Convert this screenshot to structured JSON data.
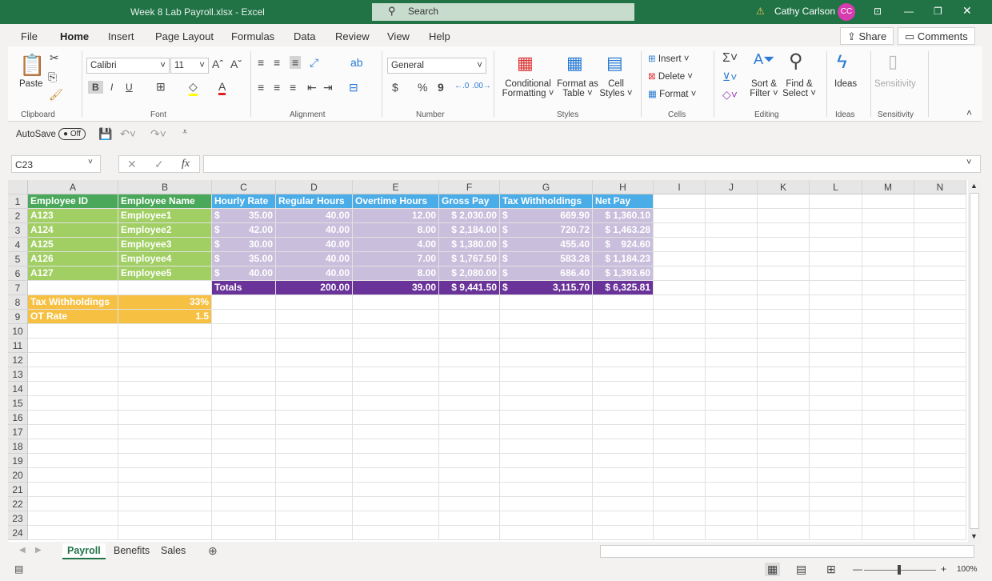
{
  "titlebar": {
    "title": "Week 8 Lab Payroll.xlsx  -  Excel",
    "search_placeholder": "Search",
    "user": "Cathy Carlson",
    "initials": "CC",
    "warning_icon": "warning-icon",
    "brand_color": "#217346"
  },
  "menu": {
    "tabs": [
      "File",
      "Home",
      "Insert",
      "Page Layout",
      "Formulas",
      "Data",
      "Review",
      "View",
      "Help"
    ],
    "active": "Home",
    "share": "Share",
    "comments": "Comments"
  },
  "ribbon": {
    "clipboard": {
      "paste": "Paste",
      "group": "Clipboard"
    },
    "font": {
      "name": "Calibri",
      "size": "11",
      "bold": "B",
      "italic": "I",
      "underline": "U",
      "group": "Font"
    },
    "alignment": {
      "group": "Alignment"
    },
    "number": {
      "format": "General",
      "currency": "$",
      "percent": "%",
      "comma": "9",
      "group": "Number"
    },
    "styles": {
      "conditional": [
        "Conditional",
        "Formatting ˅"
      ],
      "format_table": [
        "Format as",
        "Table ˅"
      ],
      "cell_styles": [
        "Cell",
        "Styles ˅"
      ],
      "group": "Styles"
    },
    "cells": {
      "insert": "Insert",
      "delete": "Delete",
      "format": "Format",
      "group": "Cells"
    },
    "editing": {
      "sort": [
        "Sort &",
        "Filter ˅"
      ],
      "find": [
        "Find &",
        "Select ˅"
      ],
      "group": "Editing"
    },
    "ideas": {
      "label": "Ideas",
      "group": "Ideas"
    },
    "sensitivity": {
      "label": "Sensitivity",
      "group": "Sensitivity"
    }
  },
  "qat": {
    "autosave": "AutoSave",
    "toggle": "Off"
  },
  "formula_bar": {
    "name_box": "C23",
    "fx": "fx",
    "value": ""
  },
  "sheet": {
    "columns": [
      "A",
      "B",
      "C",
      "D",
      "E",
      "F",
      "G",
      "H",
      "I",
      "J",
      "K",
      "L",
      "M",
      "N"
    ],
    "row_count": 24,
    "colors": {
      "green_header": "#4aa85a",
      "green": "#a1cf63",
      "blue_header": "#4bade8",
      "lavender": "#c9bedb",
      "purple": "#6a3399",
      "orange": "#f6c142"
    },
    "rows": [
      [
        "Employee ID",
        "Employee Name",
        "Hourly Rate",
        "Regular Hours",
        "Overtime Hours",
        "Gross Pay",
        "Tax Withholdings",
        "Net Pay"
      ],
      [
        "A123",
        "Employee1",
        "$ 35.00",
        "40.00",
        "12.00",
        "$ 2,030.00",
        "$ 669.90",
        "$ 1,360.10"
      ],
      [
        "A124",
        "Employee2",
        "$ 42.00",
        "40.00",
        "8.00",
        "$ 2,184.00",
        "$ 720.72",
        "$ 1,463.28"
      ],
      [
        "A125",
        "Employee3",
        "$ 30.00",
        "40.00",
        "4.00",
        "$ 1,380.00",
        "$ 455.40",
        "$    924.60"
      ],
      [
        "A126",
        "Employee4",
        "$ 35.00",
        "40.00",
        "7.00",
        "$ 1,767.50",
        "$ 583.28",
        "$ 1,184.23"
      ],
      [
        "A127",
        "Employee5",
        "$ 40.00",
        "40.00",
        "8.00",
        "$ 2,080.00",
        "$ 686.40",
        "$ 1,393.60"
      ],
      [
        "",
        "",
        "Totals",
        "200.00",
        "39.00",
        "$ 9,441.50",
        "$ 3,115.70",
        "$ 6,325.81"
      ],
      [
        "Tax Withholdings",
        "33%",
        "",
        "",
        "",
        "",
        "",
        ""
      ],
      [
        "OT Rate",
        "1.5",
        "",
        "",
        "",
        "",
        "",
        ""
      ]
    ]
  },
  "sheet_tabs": {
    "tabs": [
      "Payroll",
      "Benefits",
      "Sales"
    ],
    "active": "Payroll"
  },
  "status": {
    "zoom": "100%"
  }
}
